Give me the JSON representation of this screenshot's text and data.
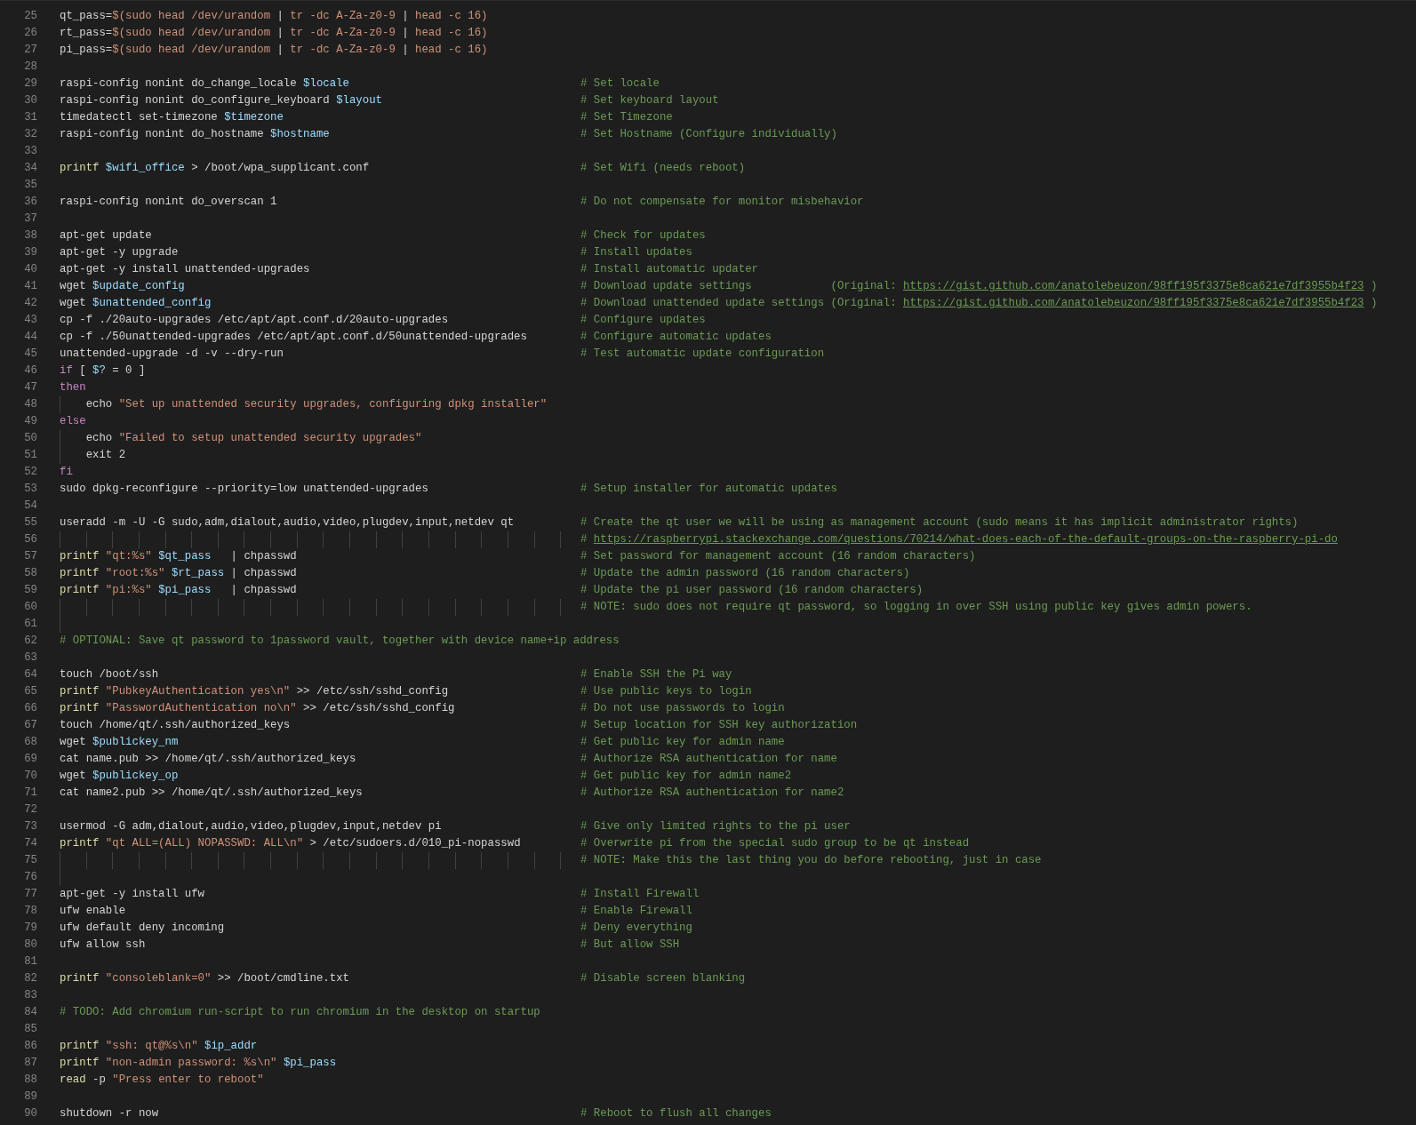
{
  "editor": {
    "lines": [
      {
        "number": "25",
        "code": [
          {
            "kind": "plain",
            "text": "qt_pass="
          },
          {
            "kind": "string",
            "text": "$(sudo head /dev/urandom "
          },
          {
            "kind": "plain",
            "text": "|"
          },
          {
            "kind": "string",
            "text": " tr -dc A-Za-z0-9 "
          },
          {
            "kind": "plain",
            "text": "|"
          },
          {
            "kind": "string",
            "text": " head -c 16)"
          }
        ]
      },
      {
        "number": "26",
        "code": [
          {
            "kind": "plain",
            "text": "rt_pass="
          },
          {
            "kind": "string",
            "text": "$(sudo head /dev/urandom "
          },
          {
            "kind": "plain",
            "text": "|"
          },
          {
            "kind": "string",
            "text": " tr -dc A-Za-z0-9 "
          },
          {
            "kind": "plain",
            "text": "|"
          },
          {
            "kind": "string",
            "text": " head -c 16)"
          }
        ]
      },
      {
        "number": "27",
        "code": [
          {
            "kind": "plain",
            "text": "pi_pass="
          },
          {
            "kind": "string",
            "text": "$(sudo head /dev/urandom "
          },
          {
            "kind": "plain",
            "text": "|"
          },
          {
            "kind": "string",
            "text": " tr -dc A-Za-z0-9 "
          },
          {
            "kind": "plain",
            "text": "|"
          },
          {
            "kind": "string",
            "text": " head -c 16)"
          }
        ]
      },
      {
        "number": "28"
      },
      {
        "number": "29",
        "code": [
          {
            "kind": "plain",
            "text": "raspi-config nonint do_change_locale "
          },
          {
            "kind": "variable",
            "text": "$locale"
          }
        ],
        "comment": [
          {
            "kind": "comment",
            "text": "# Set locale"
          }
        ]
      },
      {
        "number": "30",
        "code": [
          {
            "kind": "plain",
            "text": "raspi-config nonint do_configure_keyboard "
          },
          {
            "kind": "variable",
            "text": "$layout"
          }
        ],
        "comment": [
          {
            "kind": "comment",
            "text": "# Set keyboard layout"
          }
        ]
      },
      {
        "number": "31",
        "code": [
          {
            "kind": "plain",
            "text": "timedatectl set-timezone "
          },
          {
            "kind": "variable",
            "text": "$timezone"
          }
        ],
        "comment": [
          {
            "kind": "comment",
            "text": "# Set Timezone"
          }
        ]
      },
      {
        "number": "32",
        "code": [
          {
            "kind": "plain",
            "text": "raspi-config nonint do_hostname "
          },
          {
            "kind": "variable",
            "text": "$hostname"
          }
        ],
        "comment": [
          {
            "kind": "comment",
            "text": "# Set Hostname (Configure individually)"
          }
        ]
      },
      {
        "number": "33"
      },
      {
        "number": "34",
        "code": [
          {
            "kind": "function",
            "text": "printf "
          },
          {
            "kind": "variable",
            "text": "$wifi_office"
          },
          {
            "kind": "plain",
            "text": " > /boot/wpa_supplicant.conf"
          }
        ],
        "comment": [
          {
            "kind": "comment",
            "text": "# Set Wifi (needs reboot)"
          }
        ]
      },
      {
        "number": "35"
      },
      {
        "number": "36",
        "code": [
          {
            "kind": "plain",
            "text": "raspi-config nonint do_overscan 1"
          }
        ],
        "comment": [
          {
            "kind": "comment",
            "text": "# Do not compensate for monitor misbehavior"
          }
        ]
      },
      {
        "number": "37"
      },
      {
        "number": "38",
        "code": [
          {
            "kind": "plain",
            "text": "apt-get update"
          }
        ],
        "comment": [
          {
            "kind": "comment",
            "text": "# Check for updates"
          }
        ]
      },
      {
        "number": "39",
        "code": [
          {
            "kind": "plain",
            "text": "apt-get -y upgrade"
          }
        ],
        "comment": [
          {
            "kind": "comment",
            "text": "# Install updates"
          }
        ]
      },
      {
        "number": "40",
        "code": [
          {
            "kind": "plain",
            "text": "apt-get -y install unattended-upgrades"
          }
        ],
        "comment": [
          {
            "kind": "comment",
            "text": "# Install automatic updater"
          }
        ]
      },
      {
        "number": "41",
        "code": [
          {
            "kind": "plain",
            "text": "wget "
          },
          {
            "kind": "variable",
            "text": "$update_config"
          }
        ],
        "comment": [
          {
            "kind": "comment",
            "text": "# Download update settings            (Original: "
          },
          {
            "kind": "link",
            "text": "https://gist.github.com/anatolebeuzon/98ff195f3375e8ca621e7df3955b4f23"
          },
          {
            "kind": "comment",
            "text": " )"
          }
        ]
      },
      {
        "number": "42",
        "code": [
          {
            "kind": "plain",
            "text": "wget "
          },
          {
            "kind": "variable",
            "text": "$unattended_config"
          }
        ],
        "comment": [
          {
            "kind": "comment",
            "text": "# Download unattended update settings (Original: "
          },
          {
            "kind": "link",
            "text": "https://gist.github.com/anatolebeuzon/98ff195f3375e8ca621e7df3955b4f23"
          },
          {
            "kind": "comment",
            "text": " )"
          }
        ]
      },
      {
        "number": "43",
        "code": [
          {
            "kind": "plain",
            "text": "cp -f ./20auto-upgrades /etc/apt/apt.conf.d/20auto-upgrades"
          }
        ],
        "comment": [
          {
            "kind": "comment",
            "text": "# Configure updates"
          }
        ]
      },
      {
        "number": "44",
        "code": [
          {
            "kind": "plain",
            "text": "cp -f ./50unattended-upgrades /etc/apt/apt.conf.d/50unattended-upgrades"
          }
        ],
        "comment": [
          {
            "kind": "comment",
            "text": "# Configure automatic updates"
          }
        ]
      },
      {
        "number": "45",
        "code": [
          {
            "kind": "plain",
            "text": "unattended-upgrade -d -v --dry-run"
          }
        ],
        "comment": [
          {
            "kind": "comment",
            "text": "# Test automatic update configuration"
          }
        ]
      },
      {
        "number": "46",
        "code": [
          {
            "kind": "keyword",
            "text": "if"
          },
          {
            "kind": "plain",
            "text": " [ "
          },
          {
            "kind": "variable",
            "text": "$?"
          },
          {
            "kind": "plain",
            "text": " = 0 ]"
          }
        ]
      },
      {
        "number": "47",
        "code": [
          {
            "kind": "keyword",
            "text": "then"
          }
        ]
      },
      {
        "number": "48",
        "guide": true,
        "code": [
          {
            "kind": "plain",
            "text": "    echo "
          },
          {
            "kind": "string",
            "text": "\"Set up unattended security upgrades, configuring dpkg installer\""
          }
        ]
      },
      {
        "number": "49",
        "code": [
          {
            "kind": "keyword",
            "text": "else"
          }
        ]
      },
      {
        "number": "50",
        "guide": true,
        "code": [
          {
            "kind": "plain",
            "text": "    echo "
          },
          {
            "kind": "string",
            "text": "\"Failed to setup unattended security upgrades\""
          }
        ]
      },
      {
        "number": "51",
        "guide": true,
        "code": [
          {
            "kind": "plain",
            "text": "    exit 2"
          }
        ]
      },
      {
        "number": "52",
        "code": [
          {
            "kind": "keyword",
            "text": "fi"
          }
        ]
      },
      {
        "number": "53",
        "code": [
          {
            "kind": "plain",
            "text": "sudo dpkg-reconfigure --priority=low unattended-upgrades"
          }
        ],
        "comment": [
          {
            "kind": "comment",
            "text": "# Setup installer for automatic updates"
          }
        ]
      },
      {
        "number": "54"
      },
      {
        "number": "55",
        "code": [
          {
            "kind": "plain",
            "text": "useradd -m -U -G sudo,adm,dialout,audio,video,plugdev,input,netdev qt"
          }
        ],
        "comment": [
          {
            "kind": "comment",
            "text": "# Create the qt user we will be using as management account (sudo means it has implicit administrator rights)"
          }
        ]
      },
      {
        "number": "56",
        "guide_column": true,
        "comment": [
          {
            "kind": "comment",
            "text": "# "
          },
          {
            "kind": "link",
            "text": "https://raspberrypi.stackexchange.com/questions/70214/what-does-each-of-the-default-groups-on-the-raspberry-pi-do"
          }
        ]
      },
      {
        "number": "57",
        "code": [
          {
            "kind": "function",
            "text": "printf "
          },
          {
            "kind": "string",
            "text": "\"qt:%s\" "
          },
          {
            "kind": "variable",
            "text": "$qt_pass"
          },
          {
            "kind": "plain",
            "text": "   | chpasswd"
          }
        ],
        "comment": [
          {
            "kind": "comment",
            "text": "# Set password for management account (16 random characters)"
          }
        ]
      },
      {
        "number": "58",
        "code": [
          {
            "kind": "function",
            "text": "printf "
          },
          {
            "kind": "string",
            "text": "\"root:%s\" "
          },
          {
            "kind": "variable",
            "text": "$rt_pass"
          },
          {
            "kind": "plain",
            "text": " | chpasswd"
          }
        ],
        "comment": [
          {
            "kind": "comment",
            "text": "# Update the admin password (16 random characters)"
          }
        ]
      },
      {
        "number": "59",
        "code": [
          {
            "kind": "function",
            "text": "printf "
          },
          {
            "kind": "string",
            "text": "\"pi:%s\" "
          },
          {
            "kind": "variable",
            "text": "$pi_pass"
          },
          {
            "kind": "plain",
            "text": "   | chpasswd"
          }
        ],
        "comment": [
          {
            "kind": "comment",
            "text": "# Update the pi user password (16 random characters)"
          }
        ]
      },
      {
        "number": "60",
        "guide_column": true,
        "comment": [
          {
            "kind": "comment",
            "text": "# NOTE: sudo does not require qt password, so logging in over SSH using public key gives admin powers."
          }
        ]
      },
      {
        "number": "61",
        "guide": true
      },
      {
        "number": "62",
        "code": [
          {
            "kind": "comment",
            "text": "# OPTIONAL: Save qt password to 1password vault, together with device name+ip address"
          }
        ]
      },
      {
        "number": "63"
      },
      {
        "number": "64",
        "code": [
          {
            "kind": "plain",
            "text": "touch /boot/ssh"
          }
        ],
        "comment": [
          {
            "kind": "comment",
            "text": "# Enable SSH the Pi way"
          }
        ]
      },
      {
        "number": "65",
        "code": [
          {
            "kind": "function",
            "text": "printf "
          },
          {
            "kind": "string",
            "text": "\"PubkeyAuthentication yes\\n\""
          },
          {
            "kind": "plain",
            "text": " >> /etc/ssh/sshd_config"
          }
        ],
        "comment": [
          {
            "kind": "comment",
            "text": "# Use public keys to login"
          }
        ]
      },
      {
        "number": "66",
        "code": [
          {
            "kind": "function",
            "text": "printf "
          },
          {
            "kind": "string",
            "text": "\"PasswordAuthentication no\\n\""
          },
          {
            "kind": "plain",
            "text": " >> /etc/ssh/sshd_config"
          }
        ],
        "comment": [
          {
            "kind": "comment",
            "text": "# Do not use passwords to login"
          }
        ]
      },
      {
        "number": "67",
        "code": [
          {
            "kind": "plain",
            "text": "touch /home/qt/.ssh/authorized_keys"
          }
        ],
        "comment": [
          {
            "kind": "comment",
            "text": "# Setup location for SSH key authorization"
          }
        ]
      },
      {
        "number": "68",
        "code": [
          {
            "kind": "plain",
            "text": "wget "
          },
          {
            "kind": "variable",
            "text": "$publickey_nm"
          }
        ],
        "comment": [
          {
            "kind": "comment",
            "text": "# Get public key for admin name"
          }
        ]
      },
      {
        "number": "69",
        "code": [
          {
            "kind": "plain",
            "text": "cat name.pub >> /home/qt/.ssh/authorized_keys"
          }
        ],
        "comment": [
          {
            "kind": "comment",
            "text": "# Authorize RSA authentication for name"
          }
        ]
      },
      {
        "number": "70",
        "code": [
          {
            "kind": "plain",
            "text": "wget "
          },
          {
            "kind": "variable",
            "text": "$publickey_op"
          }
        ],
        "comment": [
          {
            "kind": "comment",
            "text": "# Get public key for admin name2"
          }
        ]
      },
      {
        "number": "71",
        "code": [
          {
            "kind": "plain",
            "text": "cat name2.pub >> /home/qt/.ssh/authorized_keys"
          }
        ],
        "comment": [
          {
            "kind": "comment",
            "text": "# Authorize RSA authentication for name2"
          }
        ]
      },
      {
        "number": "72"
      },
      {
        "number": "73",
        "code": [
          {
            "kind": "plain",
            "text": "usermod -G adm,dialout,audio,video,plugdev,input,netdev pi"
          }
        ],
        "comment": [
          {
            "kind": "comment",
            "text": "# Give only limited rights to the pi user"
          }
        ]
      },
      {
        "number": "74",
        "code": [
          {
            "kind": "function",
            "text": "printf "
          },
          {
            "kind": "string",
            "text": "\"qt ALL=(ALL) NOPASSWD: ALL\\n\""
          },
          {
            "kind": "plain",
            "text": " > /etc/sudoers.d/010_pi-nopasswd"
          }
        ],
        "comment": [
          {
            "kind": "comment",
            "text": "# Overwrite pi from the special sudo group to be qt instead"
          }
        ]
      },
      {
        "number": "75",
        "guide_column": true,
        "comment": [
          {
            "kind": "comment",
            "text": "# NOTE: Make this the last thing you do before rebooting, just in case"
          }
        ]
      },
      {
        "number": "76",
        "guide": true
      },
      {
        "number": "77",
        "code": [
          {
            "kind": "plain",
            "text": "apt-get -y install ufw"
          }
        ],
        "comment": [
          {
            "kind": "comment",
            "text": "# Install Firewall"
          }
        ]
      },
      {
        "number": "78",
        "code": [
          {
            "kind": "plain",
            "text": "ufw enable"
          }
        ],
        "comment": [
          {
            "kind": "comment",
            "text": "# Enable Firewall"
          }
        ]
      },
      {
        "number": "79",
        "code": [
          {
            "kind": "plain",
            "text": "ufw default deny incoming"
          }
        ],
        "comment": [
          {
            "kind": "comment",
            "text": "# Deny everything"
          }
        ]
      },
      {
        "number": "80",
        "code": [
          {
            "kind": "plain",
            "text": "ufw allow ssh"
          }
        ],
        "comment": [
          {
            "kind": "comment",
            "text": "# But allow SSH"
          }
        ]
      },
      {
        "number": "81"
      },
      {
        "number": "82",
        "code": [
          {
            "kind": "function",
            "text": "printf "
          },
          {
            "kind": "string",
            "text": "\"consoleblank=0\""
          },
          {
            "kind": "plain",
            "text": " >> /boot/cmdline.txt"
          }
        ],
        "comment": [
          {
            "kind": "comment",
            "text": "# Disable screen blanking"
          }
        ]
      },
      {
        "number": "83"
      },
      {
        "number": "84",
        "code": [
          {
            "kind": "comment",
            "text": "# TODO: Add chromium run-script to run chromium in the desktop on startup"
          }
        ]
      },
      {
        "number": "85"
      },
      {
        "number": "86",
        "code": [
          {
            "kind": "function",
            "text": "printf "
          },
          {
            "kind": "string",
            "text": "\"ssh: qt@%s\\n\" "
          },
          {
            "kind": "variable",
            "text": "$ip_addr"
          }
        ]
      },
      {
        "number": "87",
        "code": [
          {
            "kind": "function",
            "text": "printf "
          },
          {
            "kind": "string",
            "text": "\"non-admin password: %s\\n\" "
          },
          {
            "kind": "variable",
            "text": "$pi_pass"
          }
        ]
      },
      {
        "number": "88",
        "code": [
          {
            "kind": "function",
            "text": "read"
          },
          {
            "kind": "plain",
            "text": " -p "
          },
          {
            "kind": "string",
            "text": "\"Press enter to reboot\""
          }
        ]
      },
      {
        "number": "89"
      },
      {
        "number": "90",
        "code": [
          {
            "kind": "plain",
            "text": "shutdown -r now"
          }
        ],
        "comment": [
          {
            "kind": "comment",
            "text": "# Reboot to flush all changes"
          }
        ]
      }
    ]
  }
}
